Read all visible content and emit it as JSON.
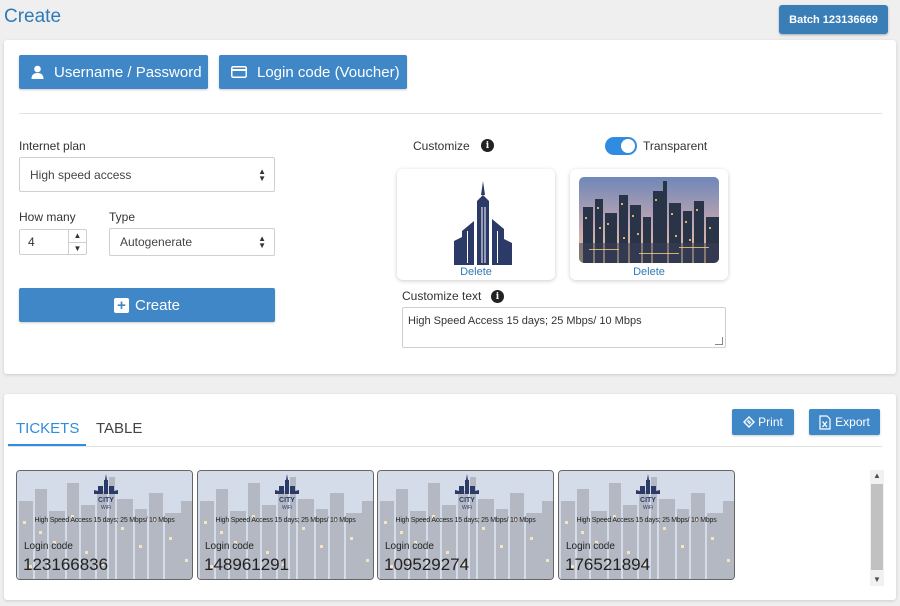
{
  "page": {
    "title": "Create",
    "batch_label": "Batch 123136669"
  },
  "modes": {
    "user_pass_label": "Username / Password",
    "voucher_label": "Login code (Voucher)"
  },
  "form": {
    "plan_label": "Internet plan",
    "plan_value": "High speed access",
    "howmany_label": "How many",
    "howmany_value": "4",
    "type_label": "Type",
    "type_value": "Autogenerate",
    "create_label": "Create"
  },
  "customize": {
    "label": "Customize",
    "transparent_label": "Transparent",
    "transparent_on": true,
    "delete_label": "Delete",
    "text_label": "Customize text",
    "text_value": "High Speed Access 15 days; 25 Mbps/ 10 Mbps"
  },
  "tabs": {
    "tickets": "TICKETS",
    "table": "TABLE"
  },
  "actions": {
    "print": "Print",
    "export": "Export"
  },
  "tickets": [
    {
      "text": "High Speed Access 15 days; 25 Mbps/ 10 Mbps",
      "label": "Login code",
      "code": "123166836"
    },
    {
      "text": "High Speed Access 15 days; 25 Mbps/ 10 Mbps",
      "label": "Login code",
      "code": "148961291"
    },
    {
      "text": "High Speed Access 15 days; 25 Mbps/ 10 Mbps",
      "label": "Login code",
      "code": "109529274"
    },
    {
      "text": "High Speed Access 15 days; 25 Mbps/ 10 Mbps",
      "label": "Login code",
      "code": "176521894"
    }
  ],
  "logo_text": {
    "line1": "CITY",
    "line2": "WiFi"
  },
  "colors": {
    "accent": "#3f87c6",
    "link": "#2f7ab8",
    "toggle": "#2f8ce0",
    "logo": "#2b3a67"
  }
}
